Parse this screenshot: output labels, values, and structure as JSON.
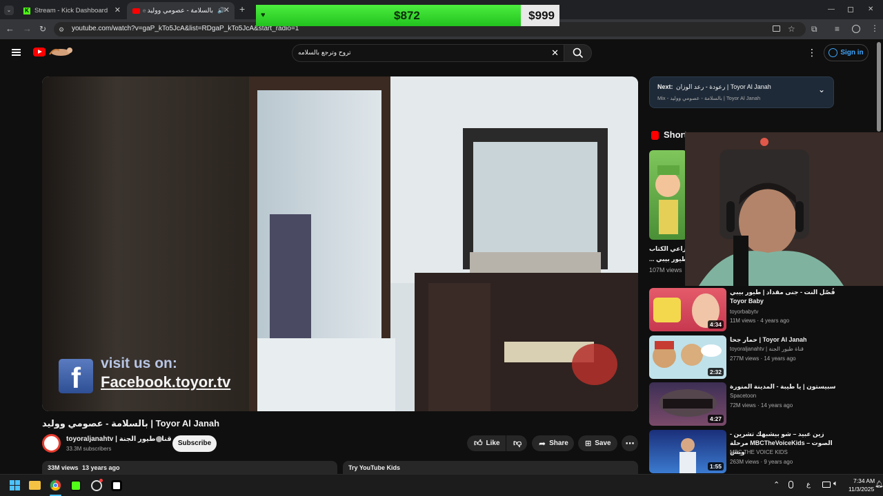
{
  "browser": {
    "tabs": [
      {
        "title": "Stream - Kick Dashboard"
      },
      {
        "title": "بالسلامة - عصومي ووليد"
      }
    ],
    "url": "youtube.com/watch?v=gaP_kTo5JcA&list=RDgaP_kTo5JcA&start_radio=1"
  },
  "overlay": {
    "progress_value": "$872",
    "goal_value": "$999",
    "progress_fraction": 0.873
  },
  "youtube": {
    "search_value": "تروح وترجع بالسلامه",
    "sign_in": "Sign in",
    "video": {
      "title": "بالسلامة - عصومي ووليد | Toyor Al Janah",
      "channel": "toyoraljanahtv | قناة طيور الجنة",
      "subscribers": "33.3M subscribers",
      "subscribe_label": "Subscribe",
      "like_label": "Like",
      "share_label": "Share",
      "save_label": "Save",
      "views": "33M views",
      "age": "13 years ago",
      "kids_label": "Try YouTube Kids",
      "overlay_line1": "visit us on:",
      "overlay_line2": "Facebook.toyor.tv"
    },
    "next": {
      "label": "Next:",
      "title": "رعودة - رعد الوزان | Toyor Al Janah",
      "subtitle": "Mix - بالسلامة - عصومي ووليد | Toyor Al Janah"
    },
    "shorts": {
      "heading": "Short",
      "caption_line1": "راعي الكتاب -",
      "caption_line2": "... طيور بيبي",
      "views": "107M views"
    },
    "recommendations": [
      {
        "title": "فُصّل النت - جنى مقداد | طيور بيبي Toyor Baby",
        "channel": "toyorbabytv",
        "meta": "11M views · 4 years ago",
        "duration": "4:34"
      },
      {
        "title": "حمار جحا | Toyor Al Janah",
        "channel": "toyoraljanahtv | قناة طيور الجنة",
        "meta": "277M views · 14 years ago",
        "duration": "2:32"
      },
      {
        "title": "سبيستون | يا طيبة - المدينة المنورة",
        "channel": "Spacetoon",
        "meta": "72M views · 14 years ago",
        "duration": "4:27"
      },
      {
        "title": "زين عبيد – شو بيشبهك تشرين - مرحلة MBCTheVoiceKids – الصوت ويس",
        "channel": "MBC THE VOICE KIDS",
        "meta": "263M views · 9 years ago",
        "duration": "1:55"
      }
    ]
  },
  "taskbar": {
    "time": "7:34 AM",
    "date": "11/3/2025",
    "lang": "ع"
  },
  "colors": {
    "goal_green": "#2fe02b",
    "link_blue": "#3ea6ff",
    "youtube_red": "#ff0000"
  }
}
